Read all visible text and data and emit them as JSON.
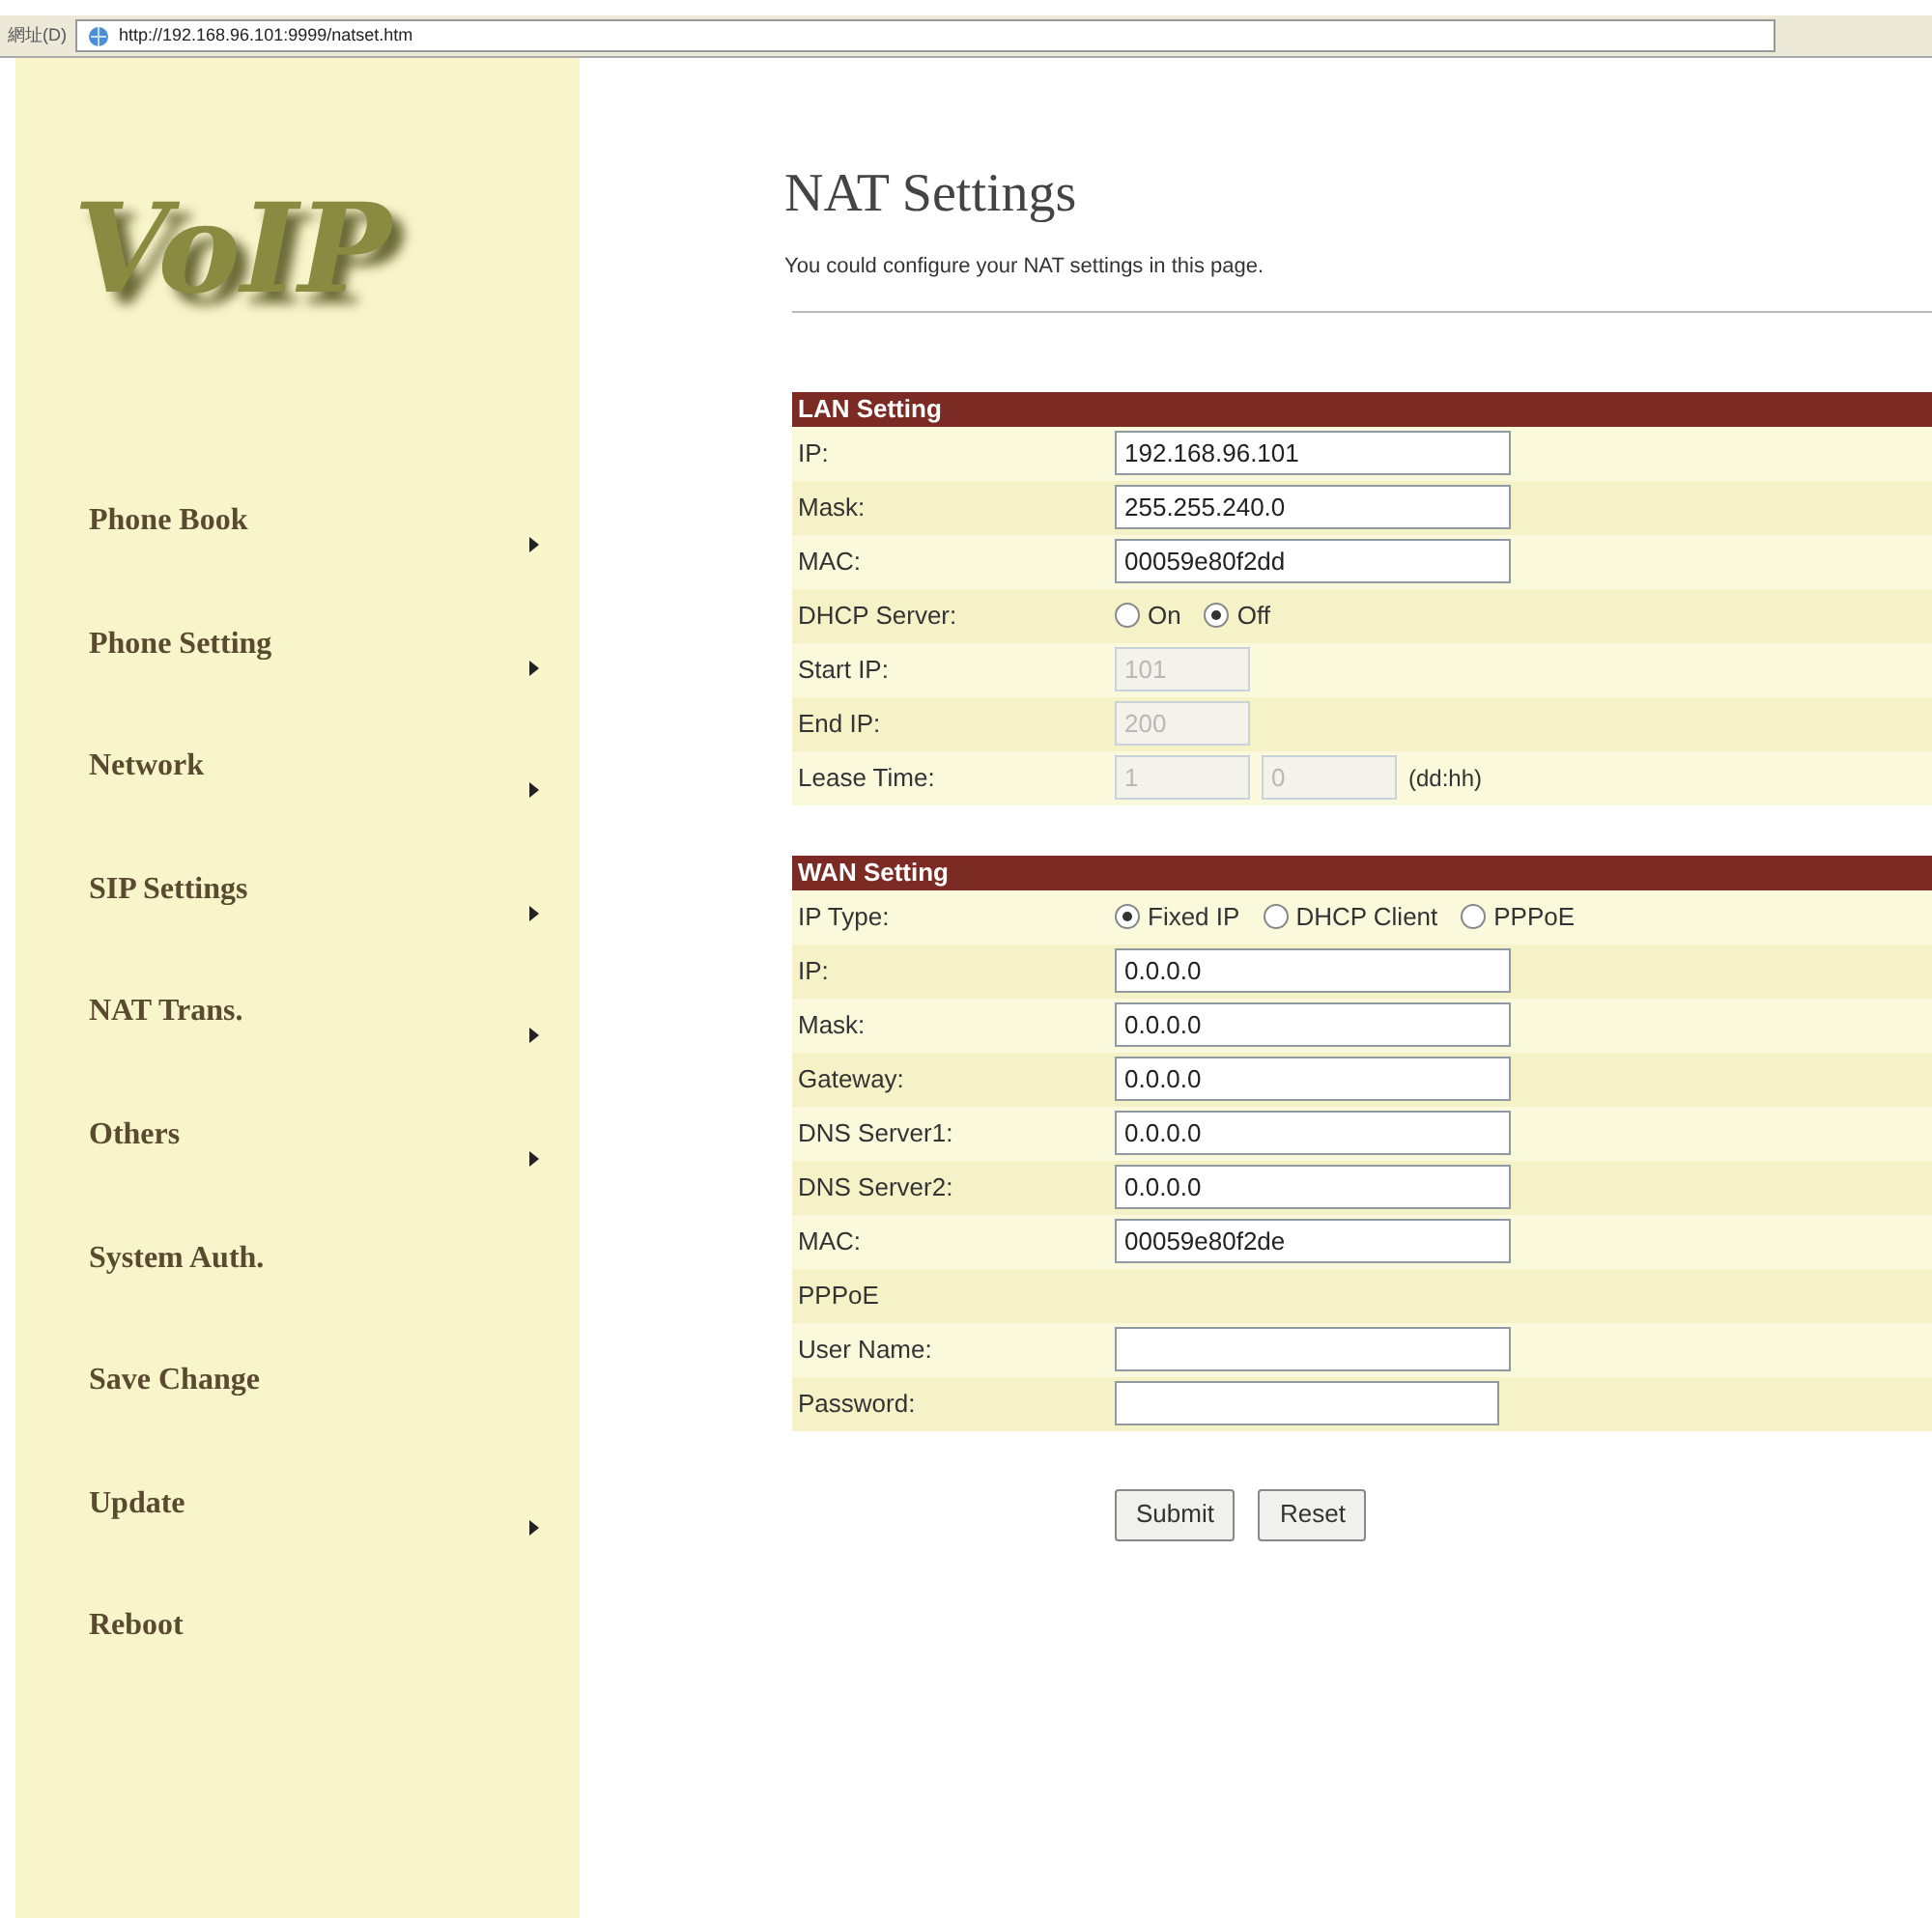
{
  "address_bar": {
    "label": "網址(D)",
    "url": "http://192.168.96.101:9999/natset.htm"
  },
  "logo": {
    "text": "VoIP"
  },
  "sidebar": {
    "items": [
      {
        "label": "Phone Book",
        "has_submenu": true
      },
      {
        "label": "Phone Setting",
        "has_submenu": true
      },
      {
        "label": "Network",
        "has_submenu": true
      },
      {
        "label": "SIP Settings",
        "has_submenu": true
      },
      {
        "label": "NAT Trans.",
        "has_submenu": true
      },
      {
        "label": "Others",
        "has_submenu": true
      },
      {
        "label": "System Auth.",
        "has_submenu": false
      },
      {
        "label": "Save Change",
        "has_submenu": false
      },
      {
        "label": "Update",
        "has_submenu": true
      },
      {
        "label": "Reboot",
        "has_submenu": false
      }
    ]
  },
  "page": {
    "title": "NAT Settings",
    "description": "You could configure your NAT settings in this page."
  },
  "sections": [
    {
      "title": "LAN Setting",
      "rows": [
        {
          "kind": "field",
          "label": "IP:",
          "value": "192.168.96.101",
          "disabled": false
        },
        {
          "kind": "field",
          "label": "Mask:",
          "value": "255.255.240.0",
          "disabled": false
        },
        {
          "kind": "field",
          "label": "MAC:",
          "value": "00059e80f2dd",
          "disabled": false
        },
        {
          "kind": "radio",
          "label": "DHCP Server:",
          "options": [
            {
              "label": "On",
              "selected": false
            },
            {
              "label": "Off",
              "selected": true
            }
          ]
        },
        {
          "kind": "short",
          "label": "Start IP:",
          "value": "101",
          "disabled": true
        },
        {
          "kind": "short",
          "label": "End IP:",
          "value": "200",
          "disabled": true
        },
        {
          "kind": "lease",
          "label": "Lease Time:",
          "values": [
            "1",
            "0"
          ],
          "disabled": true,
          "unit": "(dd:hh)"
        }
      ]
    },
    {
      "title": "WAN Setting",
      "rows": [
        {
          "kind": "radio",
          "label": "IP Type:",
          "options": [
            {
              "label": "Fixed IP",
              "selected": true
            },
            {
              "label": "DHCP Client",
              "selected": false
            },
            {
              "label": "PPPoE",
              "selected": false
            }
          ]
        },
        {
          "kind": "field",
          "label": "IP:",
          "value": "0.0.0.0",
          "disabled": false
        },
        {
          "kind": "field",
          "label": "Mask:",
          "value": "0.0.0.0",
          "disabled": false
        },
        {
          "kind": "field",
          "label": "Gateway:",
          "value": "0.0.0.0",
          "disabled": false
        },
        {
          "kind": "field",
          "label": "DNS Server1:",
          "value": "0.0.0.0",
          "disabled": false
        },
        {
          "kind": "field",
          "label": "DNS Server2:",
          "value": "0.0.0.0",
          "disabled": false
        },
        {
          "kind": "field",
          "label": "MAC:",
          "value": "00059e80f2de",
          "disabled": false
        },
        {
          "kind": "heading",
          "label": "PPPoE"
        },
        {
          "kind": "field",
          "label": "User Name:",
          "disabled": false
        },
        {
          "kind": "password",
          "label": "Password:",
          "disabled": false
        }
      ]
    }
  ],
  "buttons": [
    "Submit",
    "Reset"
  ]
}
